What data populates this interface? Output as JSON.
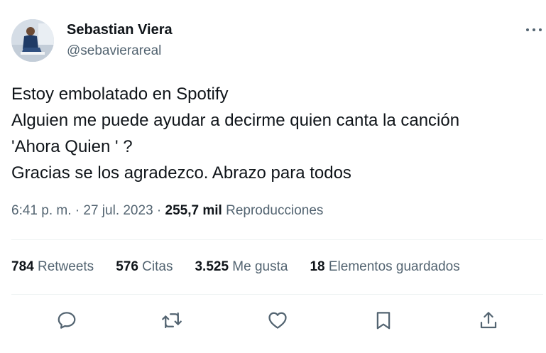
{
  "author": {
    "name": "Sebastian Viera",
    "handle": "@sebavierareal"
  },
  "tweet": {
    "lines": [
      "Estoy embolatado en Spotify",
      "Alguien me puede ayudar a decirme quien canta la canción",
      "'Ahora Quien ' ?",
      "Gracias se los agradezco. Abrazo para todos"
    ]
  },
  "meta": {
    "time": "6:41 p. m.",
    "sep1": " · ",
    "date": "27 jul. 2023",
    "sep2": " · ",
    "views_count": "255,7 mil",
    "views_label": "Reproducciones"
  },
  "stats": {
    "retweets": {
      "count": "784",
      "label": "Retweets"
    },
    "quotes": {
      "count": "576",
      "label": "Citas"
    },
    "likes": {
      "count": "3.525",
      "label": "Me gusta"
    },
    "bookmarks": {
      "count": "18",
      "label": "Elementos guardados"
    }
  },
  "icons": {
    "more": "more-horizontal-icon",
    "reply": "reply-icon",
    "retweet": "retweet-icon",
    "like": "like-icon",
    "bookmark": "bookmark-icon",
    "share": "share-icon"
  },
  "colors": {
    "text_primary": "#0f1419",
    "text_secondary": "#536471",
    "divider": "#eff3f4"
  }
}
